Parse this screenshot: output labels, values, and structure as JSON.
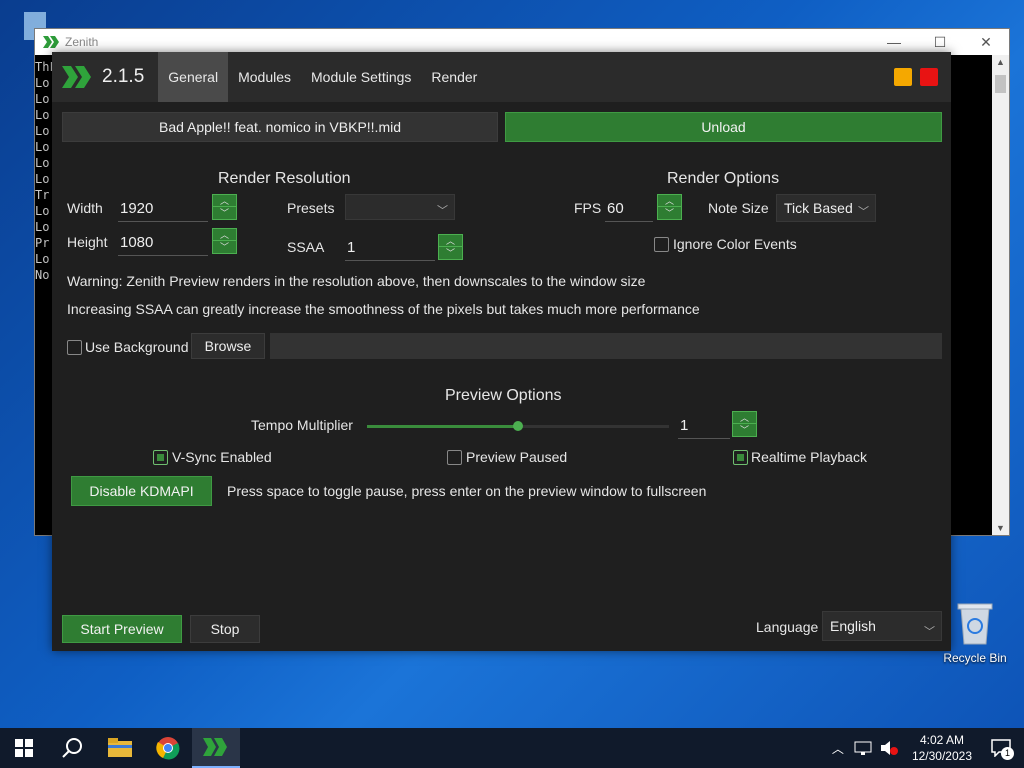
{
  "desktop": {
    "recycle_bin_label": "Recycle Bin"
  },
  "console": {
    "title": "Zenith",
    "lines": [
      "ThFa",
      "Lo",
      "Lo",
      "Lo",
      "Lo",
      "Lo",
      "Lo",
      "Lo",
      "Tr",
      "Lo",
      "Lo",
      "Pr",
      "Lo",
      "No"
    ]
  },
  "app": {
    "version": "2.1.5",
    "tabs": [
      "General",
      "Modules",
      "Module Settings",
      "Render"
    ],
    "active_tab": "General",
    "midi_file": "Bad Apple!! feat. nomico in VBKP!!.mid",
    "unload_label": "Unload",
    "render_resolution": {
      "title": "Render Resolution",
      "width_label": "Width",
      "width_value": "1920",
      "height_label": "Height",
      "height_value": "1080",
      "presets_label": "Presets",
      "presets_value": "",
      "ssaa_label": "SSAA",
      "ssaa_value": "1"
    },
    "render_options": {
      "title": "Render Options",
      "fps_label": "FPS",
      "fps_value": "60",
      "note_size_label": "Note Size",
      "note_size_value": "Tick Based",
      "ignore_color_label": "Ignore Color Events",
      "ignore_color_checked": false
    },
    "warning_text": "Warning: Zenith Preview renders in the resolution above, then downscales to the window size",
    "ssaa_info": "Increasing SSAA can greatly increase the smoothness of the pixels but takes much more performance",
    "use_background_label": "Use Background",
    "use_background_checked": false,
    "browse_label": "Browse",
    "background_path": "",
    "preview_options": {
      "title": "Preview Options",
      "tempo_label": "Tempo Multiplier",
      "tempo_value": "1",
      "tempo_slider_fraction": 0.5,
      "vsync_label": "V-Sync Enabled",
      "vsync_checked": true,
      "paused_label": "Preview Paused",
      "paused_checked": false,
      "realtime_label": "Realtime Playback",
      "realtime_checked": true
    },
    "kdmapi_label": "Disable KDMAPI",
    "hint_text": "Press space to toggle pause, press enter on the preview window to fullscreen",
    "start_preview_label": "Start Preview",
    "stop_label": "Stop",
    "language_label": "Language",
    "language_value": "English",
    "colors": {
      "accent": "#2f7d32",
      "minimize": "#f5a800",
      "close": "#e81313"
    }
  },
  "taskbar": {
    "time": "4:02 AM",
    "date": "12/30/2023",
    "notification_count": "1"
  }
}
